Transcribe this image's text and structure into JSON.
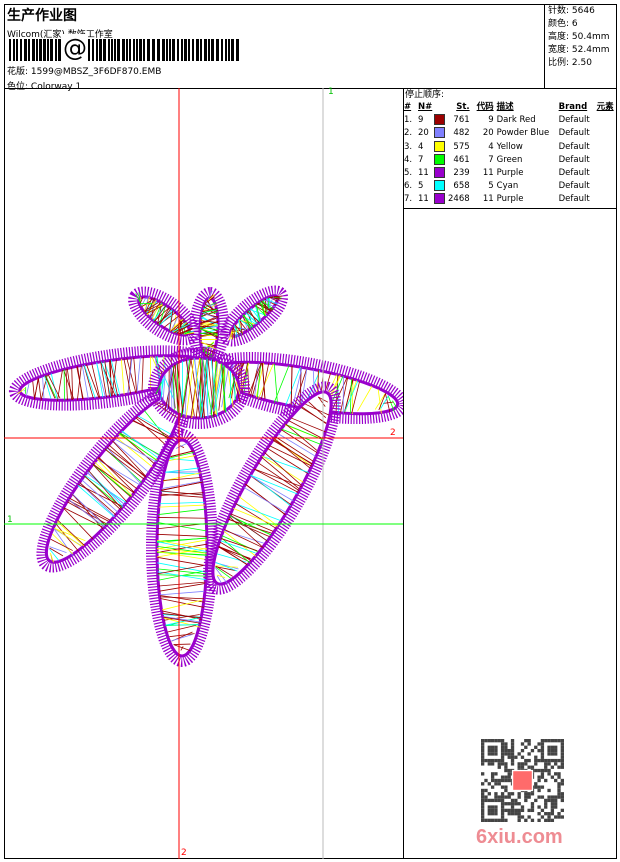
{
  "header": {
    "title": "生产作业图",
    "studio": "Wilcom(汇家) 数饰工作室",
    "barcode_text": "@",
    "design_label": "花版:",
    "design_value": "1599@MBSZ_3F6DF870.EMB",
    "colorway_label": "色位:",
    "colorway_value": "Colorway 1"
  },
  "info": [
    {
      "label": "针数:",
      "value": "5646"
    },
    {
      "label": "颜色:",
      "value": "6"
    },
    {
      "label": "高度:",
      "value": "50.4mm"
    },
    {
      "label": "宽度:",
      "value": "52.4mm"
    },
    {
      "label": "比例:",
      "value": "2.50"
    }
  ],
  "stop_sequence": {
    "title": "停止顺序:",
    "columns": [
      "#",
      "N#",
      "",
      "St.",
      "代码",
      "描述",
      "Brand",
      "元素"
    ],
    "rows": [
      {
        "idx": "1.",
        "n": "9",
        "color": "#9b0000",
        "st": "761",
        "code": "9",
        "desc": "Dark Red",
        "brand": "Default"
      },
      {
        "idx": "2.",
        "n": "20",
        "color": "#8080ff",
        "st": "482",
        "code": "20",
        "desc": "Powder Blue",
        "brand": "Default"
      },
      {
        "idx": "3.",
        "n": "4",
        "color": "#ffff00",
        "st": "575",
        "code": "4",
        "desc": "Yellow",
        "brand": "Default"
      },
      {
        "idx": "4.",
        "n": "7",
        "color": "#00ff00",
        "st": "461",
        "code": "7",
        "desc": "Green",
        "brand": "Default"
      },
      {
        "idx": "5.",
        "n": "11",
        "color": "#9900cc",
        "st": "239",
        "code": "11",
        "desc": "Purple",
        "brand": "Default"
      },
      {
        "idx": "6.",
        "n": "5",
        "color": "#00ffff",
        "st": "658",
        "code": "5",
        "desc": "Cyan",
        "brand": "Default"
      },
      {
        "idx": "7.",
        "n": "11",
        "color": "#9900cc",
        "st": "2468",
        "code": "11",
        "desc": "Purple",
        "brand": "Default"
      }
    ]
  },
  "guides": {
    "red_h_label": "2",
    "red_v_label": "2",
    "green_h_label": "1",
    "grey_v_label": "1",
    "red": "#ff0000",
    "green": "#00ff00"
  },
  "watermark": {
    "text": "6xiu.com",
    "stamp": "以图版"
  }
}
